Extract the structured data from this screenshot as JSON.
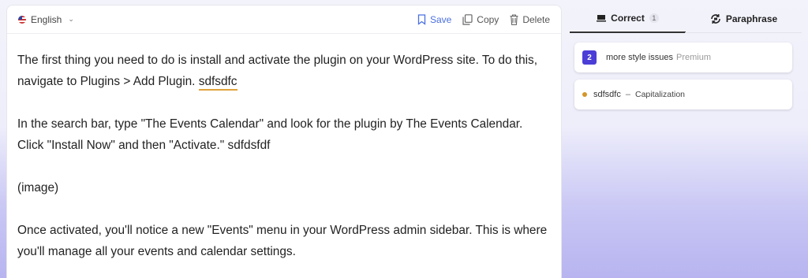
{
  "toolbar": {
    "language": "English",
    "save_label": "Save",
    "copy_label": "Copy",
    "delete_label": "Delete"
  },
  "editor": {
    "p1_text": "The first thing you need to do is install and activate the plugin on your WordPress site. To do this, navigate to Plugins > Add Plugin. ",
    "p1_error": "sdfsdfc",
    "p2_text": "In the search bar, type \"The Events Calendar\" and look for the plugin by The Events Calendar. Click \"Install Now\" and then \"Activate.\" sdfdsfdf",
    "p3_text": "(image)",
    "p4_text": "Once activated, you'll notice a new \"Events\" menu in your WordPress admin sidebar. This is where you'll manage all your events and calendar settings."
  },
  "side": {
    "tab_correct": "Correct",
    "tab_correct_count": "1",
    "tab_paraphrase": "Paraphrase",
    "premium_count": "2",
    "premium_text": "more style issues",
    "premium_tag": "Premium",
    "issue_word": "sdfsdfc",
    "issue_dash": "–",
    "issue_category": "Capitalization"
  },
  "colors": {
    "accent": "#4a6fe0",
    "premium_badge": "#4b3ed6",
    "issue_dot": "#d4952a",
    "error_underline": "#e0a23b"
  },
  "icons": [
    "chevron-down-icon",
    "bookmark-icon",
    "copy-icon",
    "trash-icon",
    "correct-icon",
    "paraphrase-icon"
  ]
}
